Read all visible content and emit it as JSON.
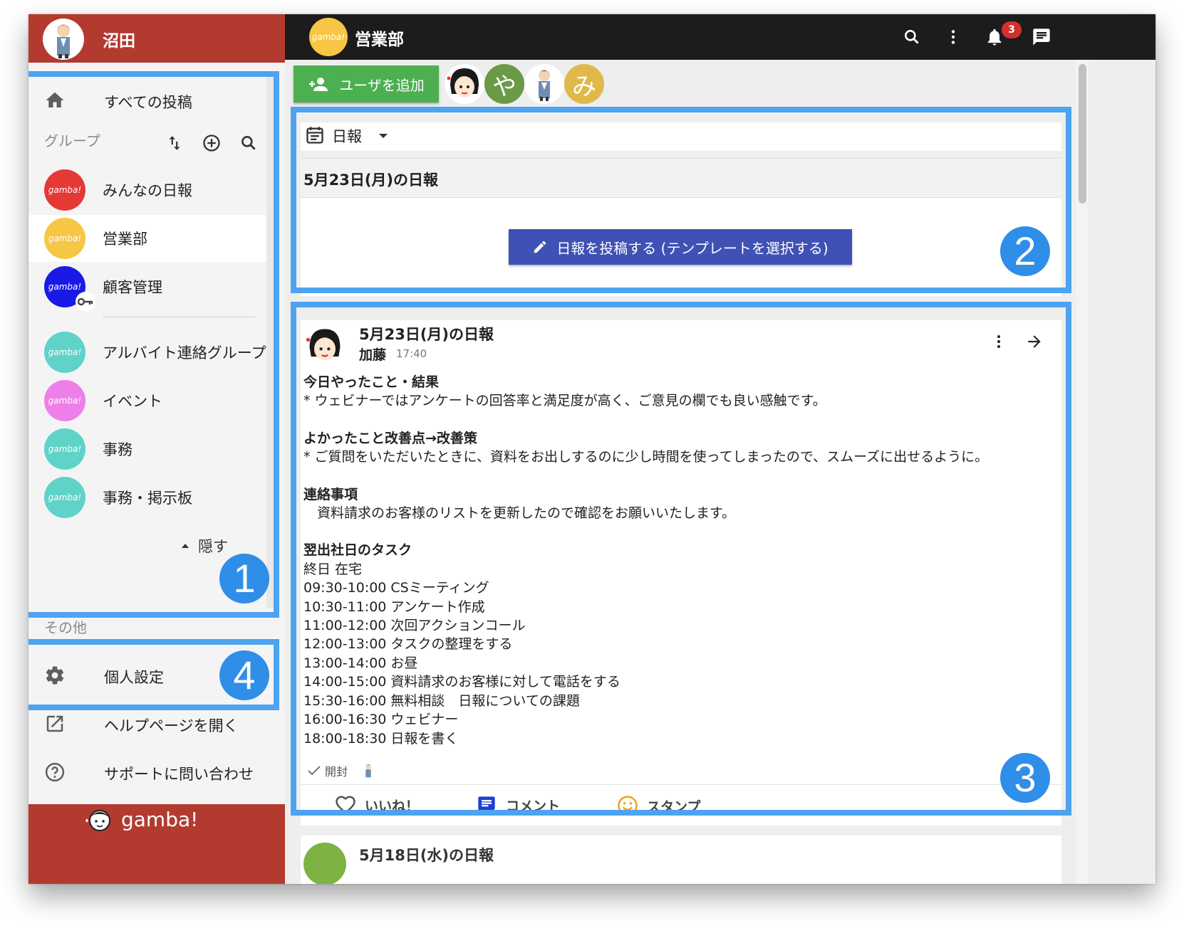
{
  "sidebar": {
    "user_name": "沼田",
    "all_posts_label": "すべての投稿",
    "groups_label": "グループ",
    "groups": [
      {
        "name": "みんなの日報",
        "logo_text": "gamba!",
        "color": "#e53935"
      },
      {
        "name": "営業部",
        "logo_text": "gamba!",
        "color": "#f6c644"
      },
      {
        "name": "顧客管理",
        "logo_text": "gamba!",
        "color": "#1a1ae6"
      },
      {
        "name": "アルバイト連絡グループ",
        "logo_text": "gamba!",
        "color": "#5fd3c8"
      },
      {
        "name": "イベント",
        "logo_text": "gamba!",
        "color": "#ef7fe8"
      },
      {
        "name": "事務",
        "logo_text": "gamba!",
        "color": "#5fd3c8"
      },
      {
        "name": "事務・掲示板",
        "logo_text": "gamba!",
        "color": "#5fd3c8"
      }
    ],
    "hide_label": "隠す",
    "other_label": "その他",
    "personal_settings_label": "個人設定",
    "help_label": "ヘルプページを開く",
    "support_label": "サポートに問い合わせ",
    "brand": "gamba!"
  },
  "topbar": {
    "group_title": "営業部",
    "group_logo_text": "gamba!",
    "notification_count": "3"
  },
  "main": {
    "add_user_label": "ユーザを追加",
    "members": [
      {
        "name": "加藤",
        "initial": "",
        "color": "#ffffff"
      },
      {
        "name": "",
        "initial": "や",
        "color": "#6a9a47"
      },
      {
        "name": "沼田",
        "initial": "",
        "color": "#ffffff"
      },
      {
        "name": "",
        "initial": "み",
        "color": "#e0b94a"
      }
    ],
    "daily": {
      "selector_label": "日報",
      "title": "5月23日(月)の日報",
      "post_button_label": "日報を投稿する (テンプレートを選択する)"
    },
    "post": {
      "title": "5月23日(月)の日報",
      "author": "加藤",
      "time": "17:40",
      "body": [
        {
          "heading": "今日やったこと・結果",
          "lines": [
            "* ウェビナーではアンケートの回答率と満足度が高く、ご意見の欄でも良い感触です。"
          ]
        },
        {
          "heading": "よかったこと改善点→改善策",
          "lines": [
            "* ご質問をいただいたときに、資料をお出しするのに少し時間を使ってしまったので、スムーズに出せるように。"
          ]
        },
        {
          "heading": "連絡事項",
          "lines": [
            "　資料請求のお客様のリストを更新したので確認をお願いいたします。"
          ]
        },
        {
          "heading": "翌出社日のタスク",
          "lines": [
            "終日 在宅",
            "09:30-10:00 CSミーティング",
            "10:30-11:00 アンケート作成",
            "11:00-12:00 次回アクションコール",
            "12:00-13:00 タスクの整理をする",
            "13:00-14:00 お昼",
            "14:00-15:00 資料請求のお客様に対して電話をする",
            "15:30-16:00 無料相談　日報についての課題",
            "16:00-16:30 ウェビナー",
            "18:00-18:30 日報を書く"
          ]
        }
      ],
      "read_label": "開封",
      "like_label": "いいね！",
      "comment_label": "コメント",
      "stamp_label": "スタンプ"
    },
    "next_post_title": "5月18日(水)の日報"
  },
  "annotations": [
    "1",
    "2",
    "3",
    "4"
  ],
  "colors": {
    "sidebar_header": "#b33a2f",
    "topbar": "#1c1c1c",
    "add_user": "#4caf50",
    "post_button": "#3f51b5",
    "annotation": "#4da3ef"
  }
}
